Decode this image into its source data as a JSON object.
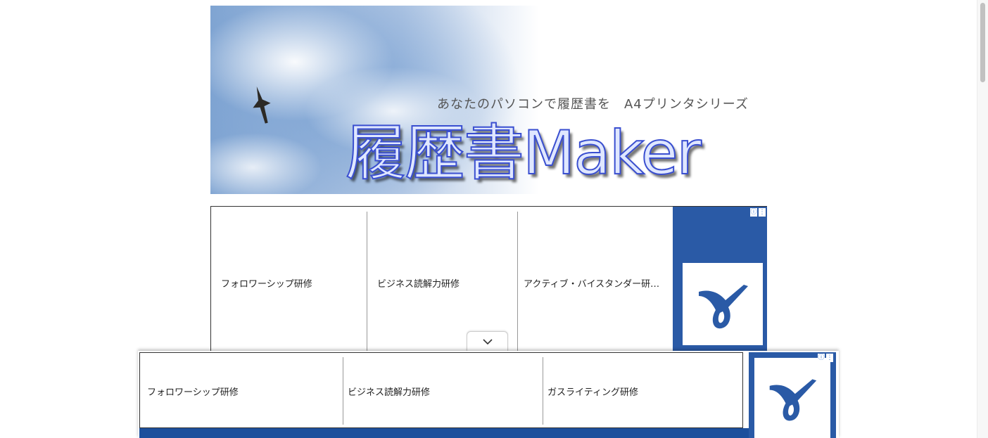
{
  "banner": {
    "tagline": "あなたのパソコンで履歴書を　A4プリンタシリーズ",
    "brand": "履歴書Maker"
  },
  "ad_top": {
    "items": [
      "フォロワーシップ研修",
      "ビジネス読解力研修",
      "アクティブ・バイスタンダー研…"
    ],
    "info_icon": "ⓘ",
    "menu_icon": "⋮",
    "brand_color": "#2a5aa6"
  },
  "anchor_ad": {
    "items": [
      "フォロワーシップ研修",
      "ビジネス読解力研修",
      "ガスライティング研修"
    ],
    "info_icon": "ⓘ",
    "menu_icon": "⋮",
    "brand_color": "#2a5aa6"
  },
  "collapse": {
    "icon": "chevron-down-icon"
  }
}
